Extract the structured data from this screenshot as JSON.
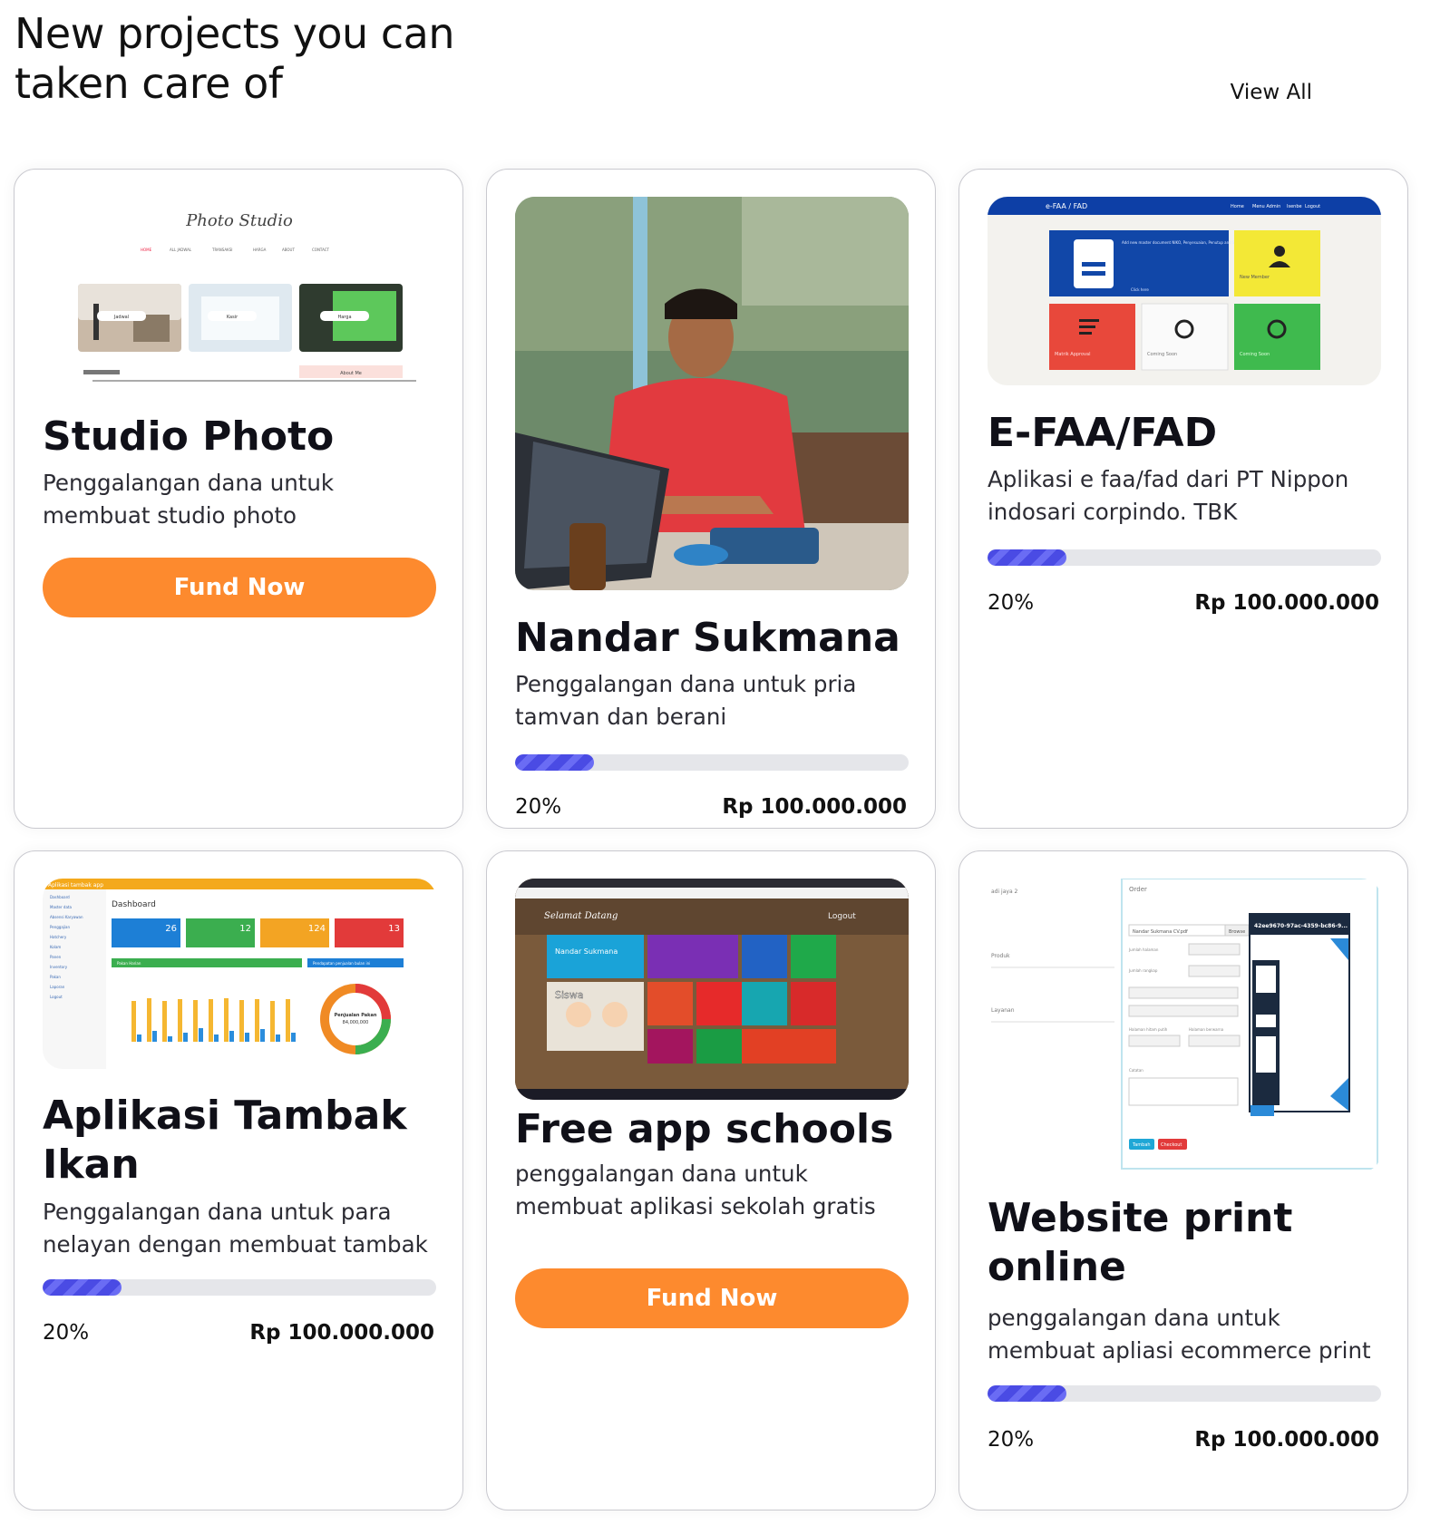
{
  "header": {
    "title": "New projects you can taken care of",
    "view_all": "View All"
  },
  "colors": {
    "accent": "#fd8a2e",
    "progress": "#4a4be4",
    "progress_track": "#e5e6ea",
    "card_border": "#c9c9cf"
  },
  "thumbs": {
    "studio": {
      "title": "Photo Studio",
      "nav": [
        "HOME",
        "ALL JADWAL",
        "TRANSAKSI",
        "HARGA",
        "ABOUT",
        "CONTACT"
      ],
      "tiles": [
        "Jadwal",
        "Kasir",
        "Harga"
      ],
      "footer": "About Me"
    },
    "efaa": {
      "appname": "e-FAA / FAD",
      "nav": [
        "Home",
        "Menu Admin",
        "Isenbe",
        "Logout"
      ],
      "tile_main": "Add new master document NIKO, Penyesuaian, Penutup and SPPL",
      "tiles": [
        "New Member",
        "Matrik Approval",
        "Coming Soon",
        "Coming Soon"
      ],
      "click": "Click here"
    },
    "tambak": {
      "appname": "Aplikasi tambak app",
      "heading": "Dashboard",
      "stats": [
        "26",
        "12",
        "124",
        "13"
      ],
      "panel1": "Pakan Harian",
      "panel2": "Pendapatan penjualan bulan ini",
      "donut": "Penjualan Pakan",
      "donut_value": "84,000,000",
      "sidebar": [
        "Dashboard",
        "Master data",
        "Absensi Karyawan",
        "Penggajian",
        "Hatchery",
        "Kolam",
        "Panen",
        "Inventory",
        "Pakan",
        "Laporan",
        "Logout"
      ]
    },
    "school": {
      "greeting": "Selamat Datang",
      "logout": "Logout",
      "name": "Nandar Sukmana",
      "siswa": "Siswa"
    },
    "print": {
      "order": "Order",
      "shop": "adi jaya 2",
      "produk": "Produk",
      "layanan": "Layanan",
      "file_value": "Nandar Sukmana CV.pdf",
      "browse": "Browse",
      "uuid": "42ee9670-97ac-4359-bc86-9...",
      "catatan": "Catatan",
      "tambah": "Tambah",
      "checkout": "Checkout",
      "fields": [
        "Jumlah halaman",
        "Jumlah rangkap",
        "Pilih Produk",
        "Pilih Tipe print",
        "Halaman hitam putih",
        "Halaman berwarna"
      ]
    }
  },
  "projects": [
    {
      "title": "Studio Photo",
      "description": "Penggalangan dana untuk membuat studio photo",
      "button": "Fund Now"
    },
    {
      "title": "Nandar Sukmana",
      "description": "Penggalangan dana untuk pria tamvan dan berani",
      "progress_percent": 20,
      "progress_label": "20%",
      "amount": "Rp 100.000.000"
    },
    {
      "title": "E-FAA/FAD",
      "description": "Aplikasi e faa/fad dari PT Nippon indosari corpindo. TBK",
      "progress_percent": 20,
      "progress_label": "20%",
      "amount": "Rp 100.000.000"
    },
    {
      "title": "Aplikasi Tambak Ikan",
      "description": "Penggalangan dana untuk para nelayan dengan membuat tambak untuk penyimpanan",
      "progress_percent": 20,
      "progress_label": "20%",
      "amount": "Rp 100.000.000"
    },
    {
      "title": "Free app schools",
      "description": "penggalangan dana untuk membuat aplikasi sekolah gratis",
      "button": "Fund Now"
    },
    {
      "title": "Website print online",
      "description": "penggalangan dana untuk membuat apliasi ecommerce print online",
      "progress_percent": 20,
      "progress_label": "20%",
      "amount": "Rp 100.000.000"
    }
  ]
}
